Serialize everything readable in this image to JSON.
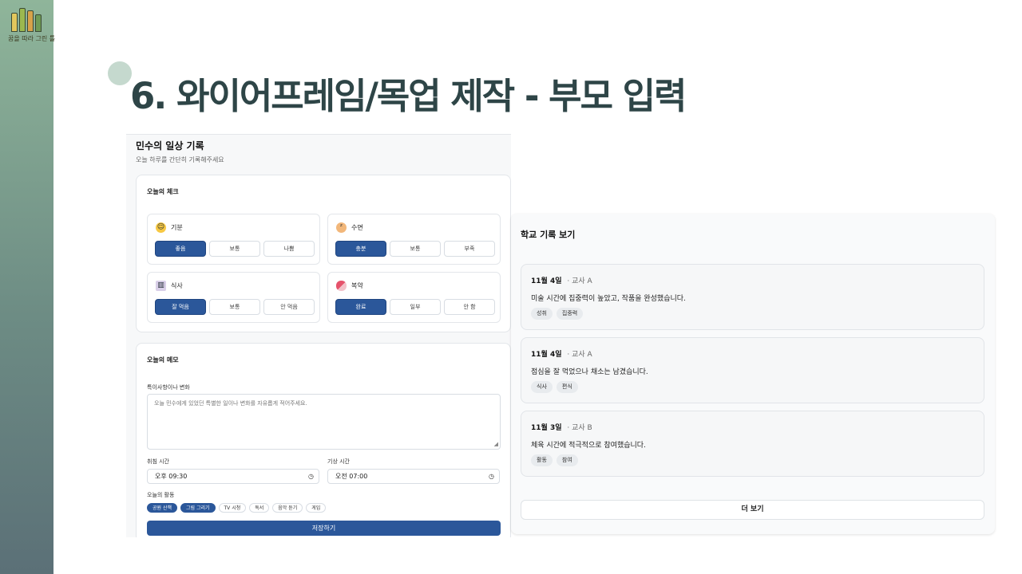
{
  "slide": {
    "logo_text": "꿈을 따라 그린 틀",
    "title": "6. 와이어프레임/목업 제작 - 부모 입력"
  },
  "daily_form": {
    "title": "민수의 일상 기록",
    "subtitle": "오늘 하루를 간단히 기록해주세요",
    "check_section_title": "오늘의 체크",
    "checks": [
      {
        "label": "기분",
        "icon": "smile-emoji-icon",
        "options": [
          "좋음",
          "보통",
          "나쁨"
        ],
        "selected": "좋음"
      },
      {
        "label": "수면",
        "icon": "sleepy-face-icon",
        "options": [
          "충분",
          "보통",
          "부족"
        ],
        "selected": "충분"
      },
      {
        "label": "식사",
        "icon": "meal-bowl-icon",
        "options": [
          "잘 먹음",
          "보통",
          "안 먹음"
        ],
        "selected": "잘 먹음"
      },
      {
        "label": "복약",
        "icon": "pill-icon",
        "options": [
          "완료",
          "일부",
          "안 함"
        ],
        "selected": "완료"
      }
    ],
    "memo_section_title": "오늘의 메모",
    "notes_label": "특이사항이나 변화",
    "notes_placeholder": "오늘 민수에게 있었던 특별한 일이나 변화를 자유롭게 적어주세요.",
    "bedtime_label": "취침 시간",
    "bedtime_value": "오후 09:30",
    "waketime_label": "기상 시간",
    "waketime_value": "오전 07:00",
    "activities_label": "오늘의 활동",
    "activities": [
      {
        "label": "공원 산책",
        "on": true
      },
      {
        "label": "그림 그리기",
        "on": true
      },
      {
        "label": "TV 시청",
        "on": false
      },
      {
        "label": "독서",
        "on": false
      },
      {
        "label": "음악 듣기",
        "on": false
      },
      {
        "label": "게임",
        "on": false
      }
    ],
    "save_label": "저장하기"
  },
  "school_records": {
    "title": "학교 기록 보기",
    "records": [
      {
        "date": "11월 4일",
        "teacher": "· 교사 A",
        "text": "미술 시간에 집중력이 높았고, 작품을 완성했습니다.",
        "tags": [
          "성취",
          "집중력"
        ]
      },
      {
        "date": "11월 4일",
        "teacher": "· 교사 A",
        "text": "점심을 잘 먹었으나 채소는 남겼습니다.",
        "tags": [
          "식사",
          "편식"
        ]
      },
      {
        "date": "11월 3일",
        "teacher": "· 교사 B",
        "text": "체육 시간에 적극적으로 참여했습니다.",
        "tags": [
          "활동",
          "참여"
        ]
      }
    ],
    "more_label": "더 보기"
  },
  "colors": {
    "accent": "#2b579a",
    "title": "#2e4547"
  }
}
